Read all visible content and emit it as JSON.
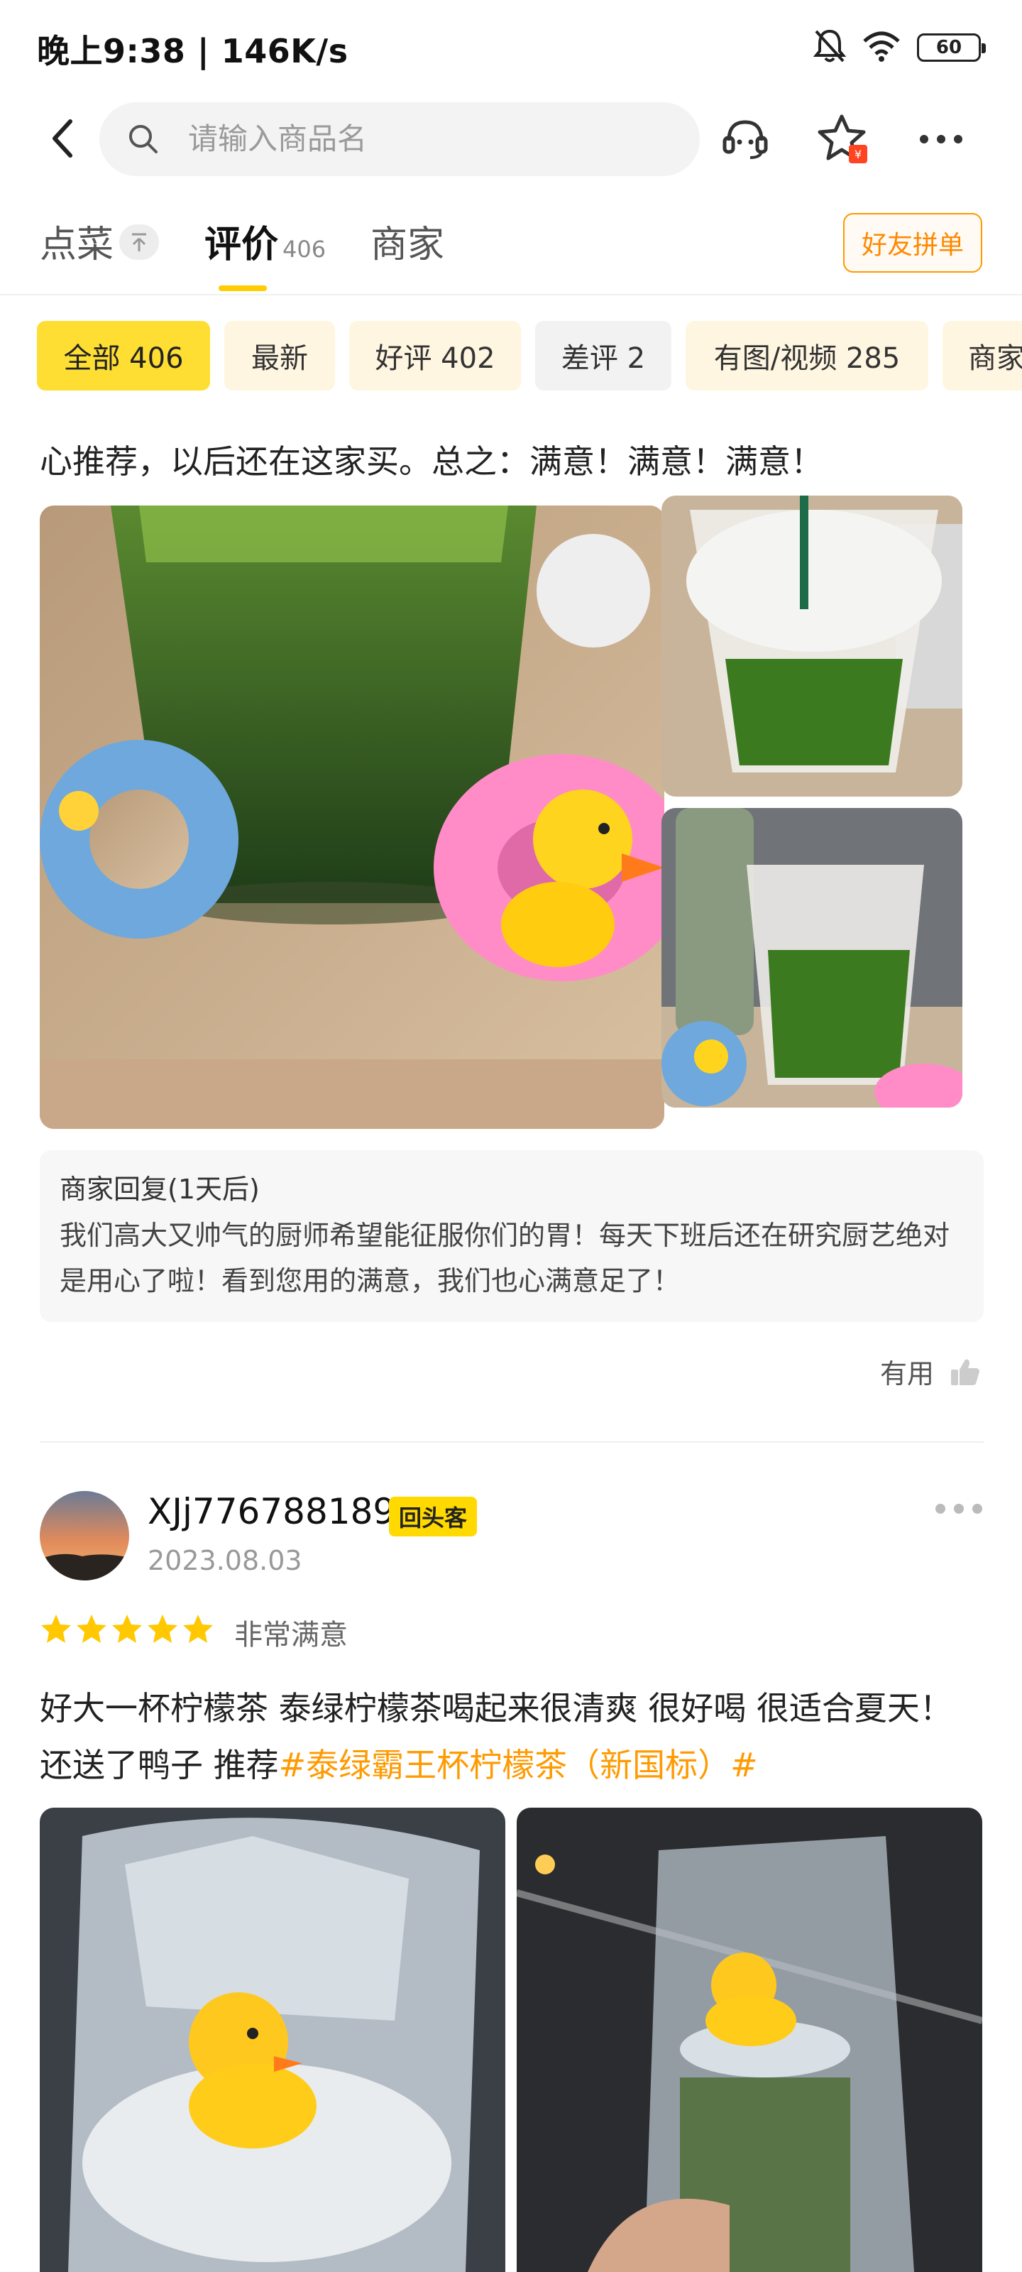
{
  "status_bar": {
    "time_speed": "晚上9:38 | 146K/s",
    "battery": "60",
    "icons": [
      "mute-bell-icon",
      "wifi-icon",
      "battery-icon"
    ]
  },
  "header": {
    "search_placeholder": "请输入商品名",
    "icons": [
      "back-arrow-icon",
      "search-icon",
      "customer-service-icon",
      "favorite-star-icon",
      "more-icon"
    ]
  },
  "tabs": {
    "items": [
      {
        "label": "点菜"
      },
      {
        "label": "评价",
        "count": "406"
      },
      {
        "label": "商家"
      }
    ],
    "friend_button": "好友拼单",
    "active_color": "#ffcc00"
  },
  "filters": [
    {
      "label": "全部 406"
    },
    {
      "label": "最新"
    },
    {
      "label": "好评 402"
    },
    {
      "label": "差评 2"
    },
    {
      "label": "有图/视频 285"
    },
    {
      "label": "商家"
    }
  ],
  "review1": {
    "text_tail": "心推荐，以后还在这家买。总之：满意！满意！满意！",
    "merchant_reply": {
      "title": "商家回复(1天后)",
      "body": "我们高大又帅气的厨师希望能征服你们的胃！每天下班后还在研究厨艺绝对是用心了啦！看到您用的满意，我们也心满意足了！"
    },
    "useful_label": "有用"
  },
  "review2": {
    "username": "XJj776788189",
    "badge": "回头客",
    "date": "2023.08.03",
    "stars": 5,
    "rating_text": "非常满意",
    "content": "好大一杯柠檬茶 泰绿柠檬茶喝起来很清爽 很好喝 很适合夏天！还送了鸭子 推荐",
    "hashtag": "#泰绿霸王杯柠檬茶（新国标）#"
  }
}
